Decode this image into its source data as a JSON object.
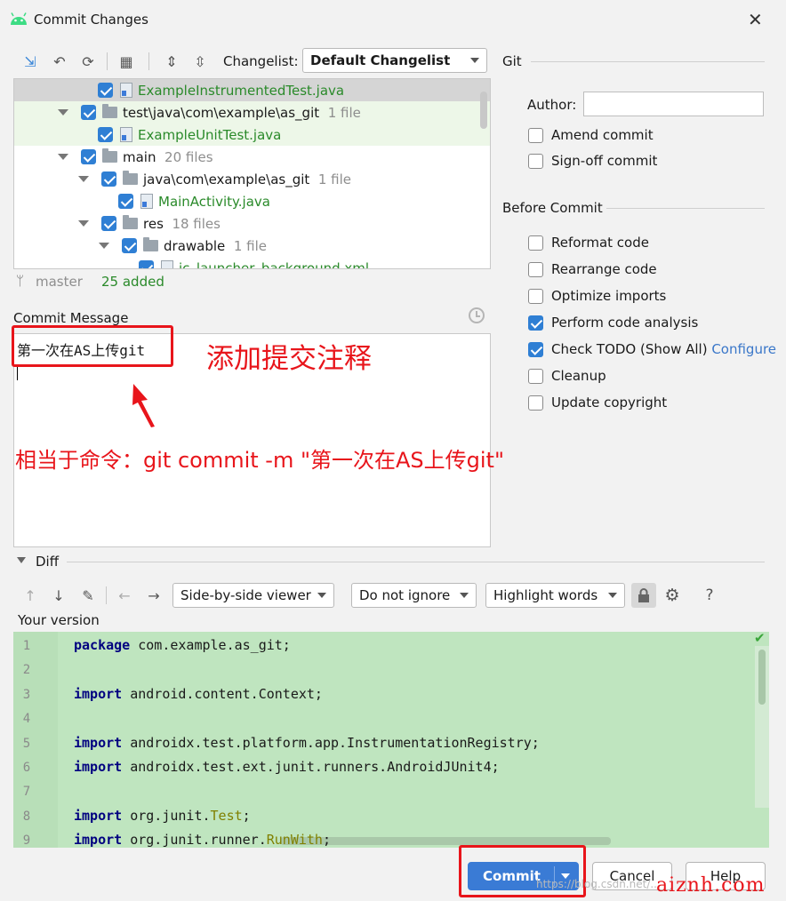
{
  "window": {
    "title": "Commit Changes"
  },
  "toolbar": {
    "changelist_label": "Changelist:",
    "changelist_value": "Default Changelist"
  },
  "git_section": {
    "title": "Git",
    "author_label": "Author:",
    "author_value": "",
    "amend": "Amend commit",
    "signoff": "Sign-off commit"
  },
  "before_commit": {
    "title": "Before Commit",
    "options": [
      {
        "label": "Reformat code",
        "checked": false
      },
      {
        "label": "Rearrange code",
        "checked": false
      },
      {
        "label": "Optimize imports",
        "checked": false
      },
      {
        "label": "Perform code analysis",
        "checked": true
      },
      {
        "label": "Check TODO (Show All)",
        "checked": true
      },
      {
        "label": "Cleanup",
        "checked": false
      },
      {
        "label": "Update copyright",
        "checked": false
      }
    ],
    "configure_link": "Configure"
  },
  "tree": {
    "rows": [
      {
        "name": "ExampleInstrumentedTest.java",
        "count": ""
      },
      {
        "name": "test\\java\\com\\example\\as_git",
        "count": "1 file"
      },
      {
        "name": "ExampleUnitTest.java",
        "count": ""
      },
      {
        "name": "main",
        "count": "20 files"
      },
      {
        "name": "java\\com\\example\\as_git",
        "count": "1 file"
      },
      {
        "name": "MainActivity.java",
        "count": ""
      },
      {
        "name": "res",
        "count": "18 files"
      },
      {
        "name": "drawable",
        "count": "1 file"
      },
      {
        "name": "ic_launcher_background.xml",
        "count": ""
      }
    ]
  },
  "status": {
    "branch": "master",
    "added": "25 added"
  },
  "commit_message": {
    "label": "Commit Message",
    "text": "第一次在AS上传git",
    "annotation_title": "添加提交注释",
    "annotation_command": "相当于命令：git commit -m \"第一次在AS上传git\""
  },
  "diff": {
    "title": "Diff",
    "viewer": "Side-by-side viewer",
    "ignore": "Do not ignore",
    "highlight": "Highlight words",
    "help_icon_text": "?",
    "your_version": "Your version",
    "lines": [
      {
        "num": "1",
        "kw": "package",
        "rest": " com.example.as_git;",
        "cls": "",
        "end": ""
      },
      {
        "num": "2",
        "kw": "",
        "rest": "",
        "cls": "",
        "end": ""
      },
      {
        "num": "3",
        "kw": "import",
        "rest": " android.content.Context;",
        "cls": "",
        "end": ""
      },
      {
        "num": "4",
        "kw": "",
        "rest": "",
        "cls": "",
        "end": ""
      },
      {
        "num": "5",
        "kw": "import",
        "rest": " androidx.test.platform.app.InstrumentationRegistry;",
        "cls": "",
        "end": ""
      },
      {
        "num": "6",
        "kw": "import",
        "rest": " androidx.test.ext.junit.runners.AndroidJUnit4;",
        "cls": "",
        "end": ""
      },
      {
        "num": "7",
        "kw": "",
        "rest": "",
        "cls": "",
        "end": ""
      },
      {
        "num": "8",
        "kw": "import",
        "rest": " org.junit.",
        "cls": "Test",
        "end": ";"
      },
      {
        "num": "9",
        "kw": "import",
        "rest": " org.junit.runner.",
        "cls": "RunWith",
        "end": ";"
      }
    ]
  },
  "buttons": {
    "commit": "Commit",
    "cancel": "Cancel",
    "help": "Help"
  },
  "watermark": {
    "url": "https://blog.csdn.net/...",
    "brand": "aiznh.com"
  },
  "colors": {
    "accent": "#2f7fd4",
    "diff_bg": "#bfe5bf",
    "annotation": "#e8151b",
    "added_file": "#2a8a2a"
  }
}
